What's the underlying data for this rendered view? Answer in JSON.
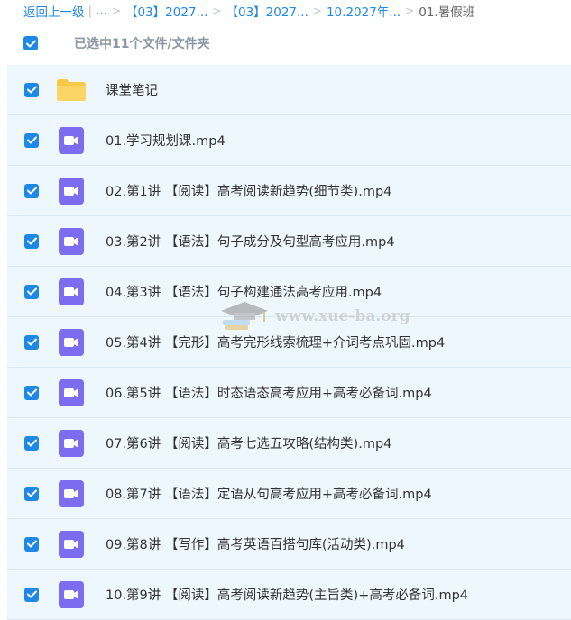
{
  "breadcrumb": {
    "back": "返回上一级",
    "ellipsis": "...",
    "items": [
      "【03】2027...",
      "【03】2027...",
      "10.2027年..."
    ],
    "current": "01.暑假班"
  },
  "selection": {
    "summary": "已选中11个文件/文件夹"
  },
  "files": [
    {
      "name": "课堂笔记",
      "type": "folder"
    },
    {
      "name": "01.学习规划课.mp4",
      "type": "video"
    },
    {
      "name": "02.第1讲 【阅读】高考阅读新趋势(细节类).mp4",
      "type": "video"
    },
    {
      "name": "03.第2讲 【语法】句子成分及句型高考应用.mp4",
      "type": "video"
    },
    {
      "name": "04.第3讲 【语法】句子构建通法高考应用.mp4",
      "type": "video"
    },
    {
      "name": "05.第4讲 【完形】高考完形线索梳理+介词考点巩固.mp4",
      "type": "video"
    },
    {
      "name": "06.第5讲 【语法】时态语态高考应用+高考必备词.mp4",
      "type": "video"
    },
    {
      "name": "07.第6讲 【阅读】高考七选五攻略(结构类).mp4",
      "type": "video"
    },
    {
      "name": "08.第7讲 【语法】定语从句高考应用+高考必备词.mp4",
      "type": "video"
    },
    {
      "name": "09.第8讲 【写作】高考英语百搭句库(活动类).mp4",
      "type": "video"
    },
    {
      "name": "10.第9讲 【阅读】高考阅读新趋势(主旨类)+高考必备词.mp4",
      "type": "video"
    }
  ],
  "watermark": {
    "text": "www.xue-ba.org"
  },
  "colors": {
    "accent": "#1e88e5",
    "row_bg": "#eef7fd",
    "folder": "#f9c84a",
    "video": "#7b6cf0"
  }
}
